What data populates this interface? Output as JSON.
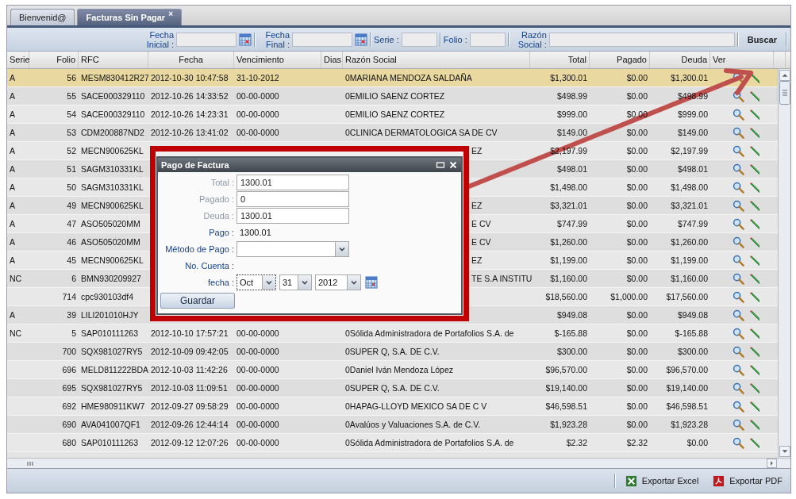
{
  "tabs": [
    {
      "label": "Bienvenid@",
      "selected": false
    },
    {
      "label": "Facturas Sin Pagar",
      "selected": true,
      "close": "×"
    }
  ],
  "filters": {
    "fecha_inicial": {
      "label": "Fecha Inicial :"
    },
    "fecha_final": {
      "label": "Fecha Final :"
    },
    "serie": {
      "label": "Serie :"
    },
    "folio": {
      "label": "Folio :"
    },
    "razon_social": {
      "label": "Razón Social :"
    },
    "search_button": "Buscar"
  },
  "table": {
    "columns": [
      "Serie",
      "Folio",
      "RFC",
      "Fecha",
      "Vencimiento",
      "Dias",
      "Razón Social",
      "Total",
      "Pagado",
      "Deuda",
      "Ver"
    ],
    "rows": [
      {
        "kind": "full",
        "selected": true,
        "serie": "A",
        "folio": "56",
        "rfc": "MESM830412R27",
        "fecha": "2012-10-30 10:47:58",
        "vencimiento": "31-10-2012",
        "razon_social": "0MARIANA MENDOZA SALDAÑA",
        "total": "$1,300.01",
        "pagado": "$0.00",
        "deuda": "$1,300.01"
      },
      {
        "kind": "full",
        "selected": false,
        "serie": "A",
        "folio": "55",
        "rfc": "SACE000329110",
        "fecha": "2012-10-26 14:33:52",
        "vencimiento": "00-00-0000",
        "razon_social": "0EMILIO SAENZ CORTEZ",
        "total": "$498.99",
        "pagado": "$0.00",
        "deuda": "$498.99"
      },
      {
        "kind": "full",
        "selected": false,
        "serie": "A",
        "folio": "54",
        "rfc": "SACE000329110",
        "fecha": "2012-10-26 14:23:31",
        "vencimiento": "00-00-0000",
        "razon_social": "0EMILIO SAENZ CORTEZ",
        "total": "$999.00",
        "pagado": "$0.00",
        "deuda": "$999.00"
      },
      {
        "kind": "full",
        "selected": false,
        "serie": "A",
        "folio": "53",
        "rfc": "CDM200887ND2",
        "fecha": "2012-10-26 13:41:02",
        "vencimiento": "00-00-0000",
        "razon_social": "0CLINICA DERMATOLOGICA SA DE CV",
        "total": "$149.00",
        "pagado": "$0.00",
        "deuda": "$149.00"
      },
      {
        "kind": "covered",
        "selected": false,
        "serie": "A",
        "folio": "52",
        "rfc": "MECN900625KL",
        "razon_social": "EZ",
        "total": "$2,197.99",
        "pagado": "$0.00",
        "deuda": "$2,197.99"
      },
      {
        "kind": "covered",
        "selected": false,
        "serie": "A",
        "folio": "51",
        "rfc": "SAGM310331KL",
        "total": "$498.01",
        "pagado": "$0.00",
        "deuda": "$498.01"
      },
      {
        "kind": "covered",
        "selected": false,
        "serie": "A",
        "folio": "50",
        "rfc": "SAGM310331KL",
        "total": "$1,498.00",
        "pagado": "$0.00",
        "deuda": "$1,498.00"
      },
      {
        "kind": "covered",
        "selected": false,
        "serie": "A",
        "folio": "49",
        "rfc": "MECN900625KL",
        "razon_social": "EZ",
        "total": "$3,321.01",
        "pagado": "$0.00",
        "deuda": "$3,321.01"
      },
      {
        "kind": "covered",
        "selected": false,
        "serie": "A",
        "folio": "47",
        "rfc": "ASO505020MM",
        "razon_social": "E CV",
        "total": "$747.99",
        "pagado": "$0.00",
        "deuda": "$747.99"
      },
      {
        "kind": "covered",
        "selected": false,
        "serie": "A",
        "folio": "46",
        "rfc": "ASO505020MM",
        "razon_social": "E CV",
        "total": "$1,260.00",
        "pagado": "$0.00",
        "deuda": "$1,260.00"
      },
      {
        "kind": "covered",
        "selected": false,
        "serie": "A",
        "folio": "45",
        "rfc": "MECN900625KL",
        "razon_social": "EZ",
        "total": "$1,199.00",
        "pagado": "$0.00",
        "deuda": "$1,199.00"
      },
      {
        "kind": "covered",
        "selected": false,
        "serie": "NC",
        "folio": "6",
        "rfc": "BMN930209927",
        "razon_social": "TE S.A INSTITU",
        "total": "$1,160.00",
        "pagado": "$0.00",
        "deuda": "$1,160.00"
      },
      {
        "kind": "covered",
        "selected": false,
        "folio": "714",
        "rfc": "cpc930103df4",
        "total": "$18,560.00",
        "pagado": "$1,000.00",
        "deuda": "$17,560.00"
      },
      {
        "kind": "covered",
        "selected": false,
        "serie": "A",
        "folio": "39",
        "rfc": "LILI201010HJY",
        "total": "$949.08",
        "pagado": "$0.00",
        "deuda": "$949.08"
      },
      {
        "kind": "full",
        "selected": false,
        "serie": "NC",
        "folio": "5",
        "rfc": "SAP010111263",
        "fecha": "2012-10-10 17:57:21",
        "vencimiento": "00-00-0000",
        "razon_social": "0Sólida Administradora de Portafolios S.A. de",
        "total": "$-165.88",
        "pagado": "$0.00",
        "deuda": "$-165.88"
      },
      {
        "kind": "full",
        "selected": false,
        "folio": "700",
        "rfc": "SQX981027RY5",
        "fecha": "2012-10-09 09:42:05",
        "vencimiento": "00-00-0000",
        "razon_social": "0SUPER Q, S.A. DE C.V.",
        "total": "$300.00",
        "pagado": "$0.00",
        "deuda": "$300.00"
      },
      {
        "kind": "full",
        "selected": false,
        "folio": "696",
        "rfc": "MELD811222BDA",
        "fecha": "2012-10-03 11:42:26",
        "vencimiento": "00-00-0000",
        "razon_social": "0Daniel Iván Mendoza López",
        "total": "$96,570.00",
        "pagado": "$0.00",
        "deuda": "$96,570.00"
      },
      {
        "kind": "full",
        "selected": false,
        "folio": "695",
        "rfc": "SQX981027RY5",
        "fecha": "2012-10-03 11:09:51",
        "vencimiento": "00-00-0000",
        "razon_social": "0SUPER Q, S.A. DE C.V.",
        "total": "$19,140.00",
        "pagado": "$0.00",
        "deuda": "$19,140.00"
      },
      {
        "kind": "full",
        "selected": false,
        "folio": "692",
        "rfc": "HME980911KW7",
        "fecha": "2012-09-27 09:58:29",
        "vencimiento": "00-00-0000",
        "razon_social": "0HAPAG-LLOYD MEXICO SA DE C V",
        "total": "$46,598.51",
        "pagado": "$0.00",
        "deuda": "$46,598.51"
      },
      {
        "kind": "full",
        "selected": false,
        "folio": "690",
        "rfc": "AVA041007QF1",
        "fecha": "2012-09-26 12:44:14",
        "vencimiento": "00-00-0000",
        "razon_social": "0Avalúos y Valuaciones S.A. de C.V.",
        "total": "$1,923.28",
        "pagado": "$0.00",
        "deuda": "$1,923.28"
      },
      {
        "kind": "full",
        "selected": false,
        "folio": "680",
        "rfc": "SAP010111263",
        "fecha": "2012-09-12 12:07:26",
        "vencimiento": "00-00-0000",
        "razon_social": "0Sólida Administradora de Portafolios S.A. de",
        "total": "$2.32",
        "pagado": "$2.32",
        "deuda": "$0.00"
      }
    ]
  },
  "dialog": {
    "title": "Pago de Factura",
    "fields": [
      {
        "kind": "input",
        "label": "Total :",
        "value": "1300.01"
      },
      {
        "kind": "input",
        "label": "Pagado :",
        "value": "0"
      },
      {
        "kind": "input",
        "label": "Deuda :",
        "value": "1300.01"
      },
      {
        "kind": "text",
        "label": "Pago :",
        "value": "1300.01"
      },
      {
        "kind": "combo",
        "label": "Método de Pago :"
      },
      {
        "kind": "blank",
        "label": "No. Cuenta :"
      },
      {
        "kind": "date",
        "label": "fecha :",
        "month": "Oct",
        "day": "31",
        "year": "2012"
      }
    ],
    "save_button": "Guardar"
  },
  "footer": {
    "buttons": [
      {
        "kind": "excel",
        "label": "Exportar Excel"
      },
      {
        "kind": "pdf",
        "label": "Exportar PDF"
      }
    ]
  }
}
